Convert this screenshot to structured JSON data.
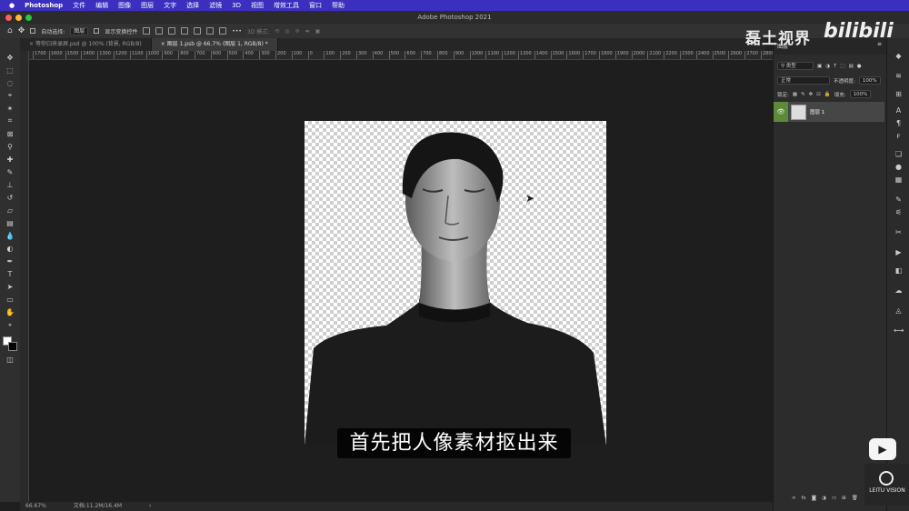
{
  "menubar": {
    "apple": "",
    "app": "Photoshop",
    "items": [
      "文件",
      "编辑",
      "图像",
      "图层",
      "文字",
      "选择",
      "滤镜",
      "3D",
      "视图",
      "增效工具",
      "窗口",
      "帮助"
    ]
  },
  "window": {
    "title": "Adobe Photoshop 2021"
  },
  "options": {
    "auto_select_label": "自动选择:",
    "auto_select_value": "图层",
    "show_transform_label": "显示变换控件",
    "mode_3d_label": "3D 模式:"
  },
  "tabs": [
    {
      "label": "等你归来录屏.psd @ 100% (背景, RGB/8)",
      "active": false
    },
    {
      "label": "图层 1.psb @ 66.7% (图层 1, RGB/8) *",
      "active": true
    }
  ],
  "ruler": {
    "ticks": [
      "1700",
      "1600",
      "1500",
      "1400",
      "1300",
      "1200",
      "1100",
      "1000",
      "900",
      "800",
      "700",
      "600",
      "500",
      "400",
      "300",
      "200",
      "100",
      "0",
      "100",
      "200",
      "300",
      "400",
      "500",
      "600",
      "700",
      "800",
      "900",
      "1000",
      "1100",
      "1200",
      "1300",
      "1400",
      "1500",
      "1600",
      "1700",
      "1800",
      "1900",
      "2000",
      "2100",
      "2200",
      "2300",
      "2400",
      "2500",
      "2600",
      "2700",
      "2800"
    ]
  },
  "subtitle": "首先把人像素材抠出来",
  "status": {
    "zoom": "66.67%",
    "doc": "文档:11.2M/16.4M"
  },
  "layers_panel": {
    "title": "图层",
    "filter_label": "类型",
    "blend_mode": "正常",
    "opacity_label": "不透明度:",
    "opacity_value": "100%",
    "lock_label": "锁定:",
    "fill_label": "填充:",
    "fill_value": "100%",
    "layers": [
      {
        "name": "图层 1",
        "visible": true
      }
    ],
    "footer_icons": [
      "link-icon",
      "fx-icon",
      "mask-icon",
      "adjustment-icon",
      "folder-icon",
      "new-layer-icon",
      "trash-icon"
    ]
  },
  "watermark": {
    "channel": "磊土视界",
    "brand": "bilibili",
    "logo_text": "LEITU VISION"
  },
  "colors": {
    "menubar": "#3a2fbf",
    "layer_selected": "#464646",
    "eye_green": "#5c8a3a"
  }
}
